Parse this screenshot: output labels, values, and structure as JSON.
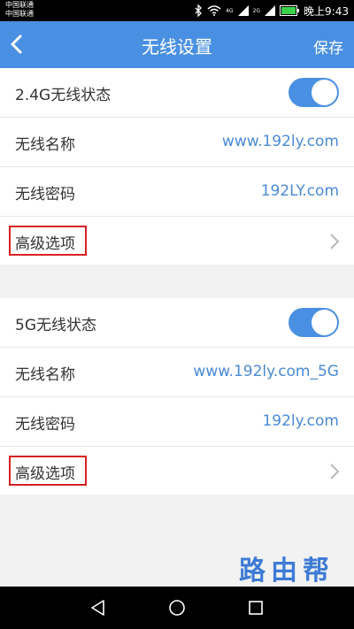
{
  "status": {
    "carrier1": "中国联通",
    "carrier2": "中国联通",
    "sig1_tag": "4G",
    "sig2_tag": "2G",
    "time": "晚上9:43"
  },
  "header": {
    "title": "无线设置",
    "save": "保存"
  },
  "section24": {
    "status_label": "2.4G无线状态",
    "status_on": true,
    "name_label": "无线名称",
    "name_value": "www.192ly.com",
    "pwd_label": "无线密码",
    "pwd_value": "192LY.com",
    "advanced_label": "高级选项"
  },
  "section5": {
    "status_label": "5G无线状态",
    "status_on": true,
    "name_label": "无线名称",
    "name_value": "www.192ly.com_5G",
    "pwd_label": "无线密码",
    "pwd_value": "192ly.com",
    "advanced_label": "高级选项"
  },
  "watermark": "路由帮",
  "colors": {
    "accent": "#4a90e2",
    "link": "#4a8ad6",
    "highlight": "#d92020"
  },
  "icons": [
    "back-icon",
    "chevron-right-icon",
    "nav-back-icon",
    "nav-home-icon",
    "nav-recents-icon",
    "bluetooth-icon",
    "wifi-icon",
    "battery-icon"
  ]
}
